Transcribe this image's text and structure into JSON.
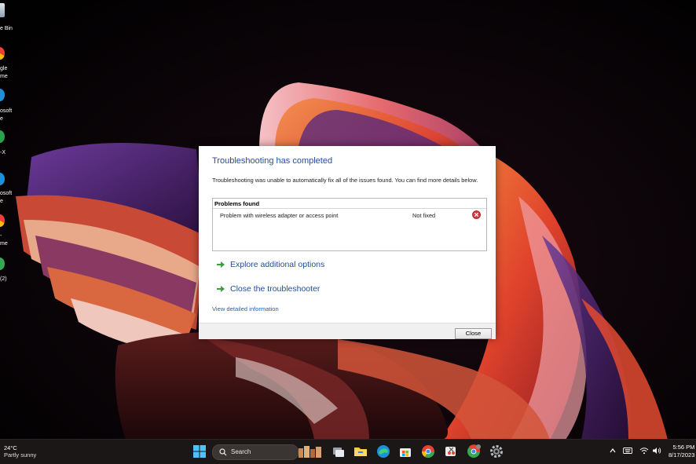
{
  "desktop": {
    "icons": [
      {
        "name": "recycle-bin",
        "label": "e Bin"
      },
      {
        "name": "google-chrome",
        "label_lines": [
          "gle",
          "me"
        ]
      },
      {
        "name": "microsoft-edge",
        "label_lines": [
          "osoft",
          "e"
        ]
      },
      {
        "name": "app-x",
        "label_lines": [
          "-X"
        ]
      },
      {
        "name": "microsoft-edge-2",
        "label_lines": [
          "osoft",
          "e"
        ]
      },
      {
        "name": "chrome-2",
        "label_lines": [
          "-",
          "me"
        ]
      },
      {
        "name": "app-2",
        "label_lines": [
          "(2)"
        ]
      }
    ]
  },
  "dialog": {
    "title": "Troubleshooting has completed",
    "description": "Troubleshooting was unable to automatically fix all of the issues found. You can find more details below.",
    "problems_header": "Problems found",
    "problems": [
      {
        "name": "Problem with wireless adapter or access point",
        "status": "Not fixed",
        "status_icon": "error-x-icon"
      }
    ],
    "options": [
      {
        "label": "Explore additional options",
        "icon": "green-arrow-icon"
      },
      {
        "label": "Close the troubleshooter",
        "icon": "green-arrow-icon"
      }
    ],
    "detail_link": "View detailed information",
    "close_button": "Close"
  },
  "taskbar": {
    "weather": {
      "temp": "24°C",
      "condition": "Partly sunny"
    },
    "search_placeholder": "Search",
    "apps": [
      "windows-start-icon",
      "task-view-icon",
      "file-explorer-icon",
      "edge-icon",
      "store-icon",
      "chrome-icon",
      "snipping-tool-icon",
      "chrome-badge-icon",
      "settings-icon"
    ],
    "tray": {
      "chevron": "^"
    },
    "clock": {
      "time": "5:56 PM",
      "date": "8/17/2023"
    }
  },
  "colors": {
    "dialog_title": "#1f4e9c",
    "link": "#1e5fbf",
    "taskbar": "#1b1716",
    "error": "#d8353f",
    "arrow": "#3aa03c"
  }
}
